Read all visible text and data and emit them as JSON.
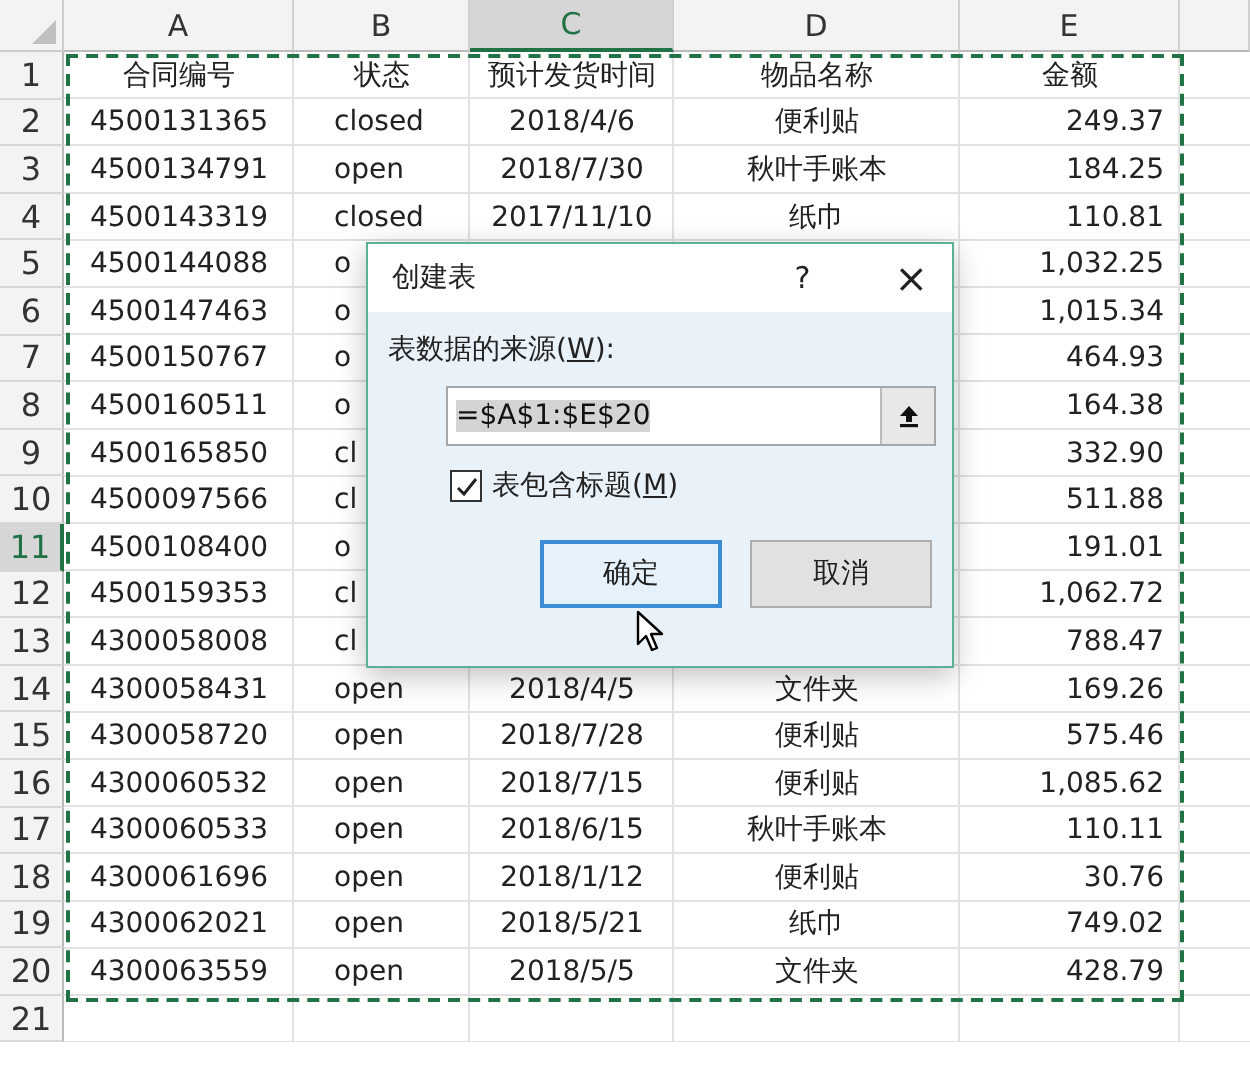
{
  "columns": [
    {
      "label": "A",
      "selected": false
    },
    {
      "label": "B",
      "selected": false
    },
    {
      "label": "C",
      "selected": true
    },
    {
      "label": "D",
      "selected": false
    },
    {
      "label": "E",
      "selected": false
    }
  ],
  "rows": [
    {
      "number": "1",
      "selected": false,
      "contract_no": "合同编号",
      "status": "状态",
      "ship_date": "预计发货时间",
      "item": "物品名称",
      "amount": "金额"
    },
    {
      "number": "2",
      "selected": false,
      "contract_no": "4500131365",
      "status": "closed",
      "ship_date": "2018/4/6",
      "item": "便利贴",
      "amount": "249.37"
    },
    {
      "number": "3",
      "selected": false,
      "contract_no": "4500134791",
      "status": "open",
      "ship_date": "2018/7/30",
      "item": "秋叶手账本",
      "amount": "184.25"
    },
    {
      "number": "4",
      "selected": false,
      "contract_no": "4500143319",
      "status": "closed",
      "ship_date": "2017/11/10",
      "item": "纸巾",
      "amount": "110.81"
    },
    {
      "number": "5",
      "selected": false,
      "contract_no": "4500144088",
      "status": "o",
      "amount": "1,032.25"
    },
    {
      "number": "6",
      "selected": false,
      "contract_no": "4500147463",
      "status": "o",
      "amount": "1,015.34"
    },
    {
      "number": "7",
      "selected": false,
      "contract_no": "4500150767",
      "status": "o",
      "amount": "464.93"
    },
    {
      "number": "8",
      "selected": false,
      "contract_no": "4500160511",
      "status": "o",
      "amount": "164.38"
    },
    {
      "number": "9",
      "selected": false,
      "contract_no": "4500165850",
      "status": "cl",
      "amount": "332.90"
    },
    {
      "number": "10",
      "selected": false,
      "contract_no": "4500097566",
      "status": "cl",
      "amount": "511.88"
    },
    {
      "number": "11",
      "selected": true,
      "contract_no": "4500108400",
      "status": "o",
      "amount": "191.01"
    },
    {
      "number": "12",
      "selected": false,
      "contract_no": "4500159353",
      "status": "cl",
      "amount": "1,062.72"
    },
    {
      "number": "13",
      "selected": false,
      "contract_no": "4300058008",
      "status": "cl",
      "amount": "788.47"
    },
    {
      "number": "14",
      "selected": false,
      "contract_no": "4300058431",
      "status": "open",
      "ship_date": "2018/4/5",
      "item": "文件夹",
      "amount": "169.26"
    },
    {
      "number": "15",
      "selected": false,
      "contract_no": "4300058720",
      "status": "open",
      "ship_date": "2018/7/28",
      "item": "便利贴",
      "amount": "575.46"
    },
    {
      "number": "16",
      "selected": false,
      "contract_no": "4300060532",
      "status": "open",
      "ship_date": "2018/7/15",
      "item": "便利贴",
      "amount": "1,085.62"
    },
    {
      "number": "17",
      "selected": false,
      "contract_no": "4300060533",
      "status": "open",
      "ship_date": "2018/6/15",
      "item": "秋叶手账本",
      "amount": "110.11"
    },
    {
      "number": "18",
      "selected": false,
      "contract_no": "4300061696",
      "status": "open",
      "ship_date": "2018/1/12",
      "item": "便利贴",
      "amount": "30.76"
    },
    {
      "number": "19",
      "selected": false,
      "contract_no": "4300062021",
      "status": "open",
      "ship_date": "2018/5/21",
      "item": "纸巾",
      "amount": "749.02"
    },
    {
      "number": "20",
      "selected": false,
      "contract_no": "4300063559",
      "status": "open",
      "ship_date": "2018/5/5",
      "item": "文件夹",
      "amount": "428.79"
    },
    {
      "number": "21",
      "selected": false
    }
  ],
  "dialog": {
    "title": "创建表",
    "help": "?",
    "close": "×",
    "source_label": {
      "before": "表数据的来源(",
      "access_key": "W",
      "after": "):"
    },
    "source_value": "=$A$1:$E$20",
    "header_checkbox": {
      "before": "表包含标题(",
      "access_key": "M",
      "after": ")",
      "checked": true
    },
    "buttons": [
      {
        "label": "确定",
        "default": true
      },
      {
        "label": "取消",
        "default": false
      }
    ]
  }
}
